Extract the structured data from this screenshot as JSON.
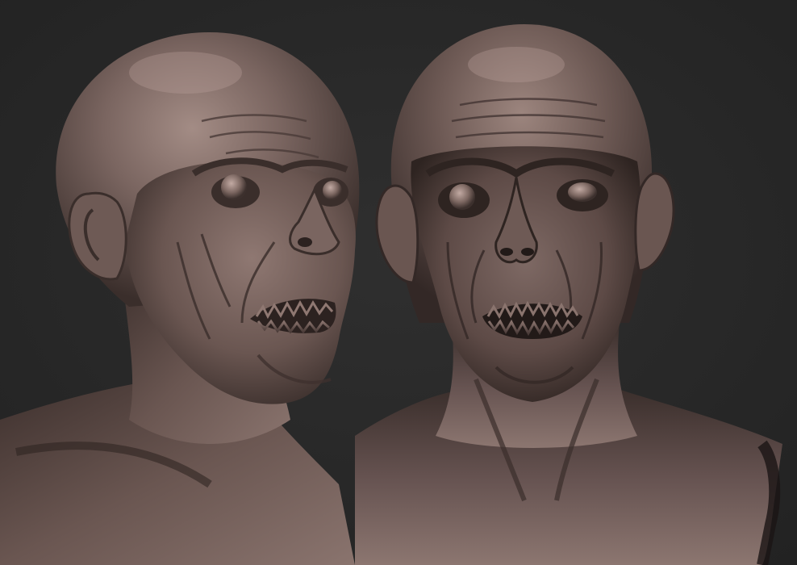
{
  "scene": {
    "background_color": "#262626",
    "clay_light": "#8c7670",
    "clay_mid": "#5e4c48",
    "clay_dark": "#2c2220",
    "highlight": "#b9a19a",
    "teeth": "#6e5a54",
    "views": [
      {
        "label_icon": "sculpt-bust-three-quarter-view"
      },
      {
        "label_icon": "sculpt-bust-front-view"
      }
    ]
  }
}
